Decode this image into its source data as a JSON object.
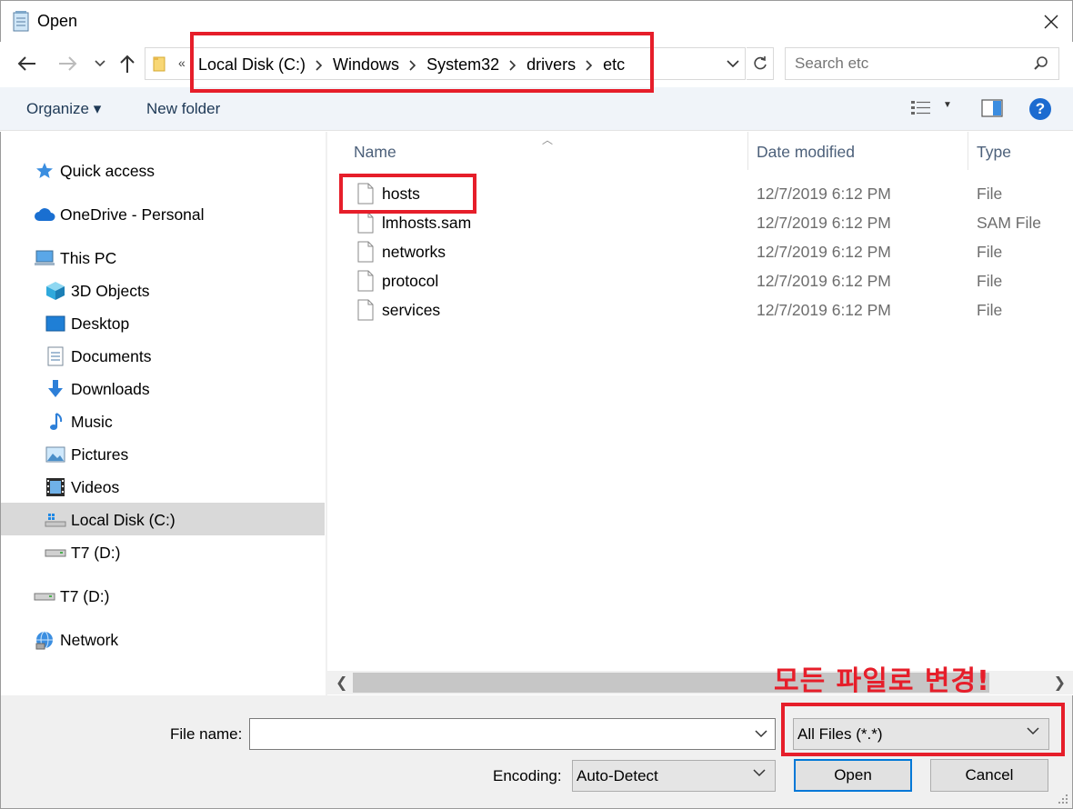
{
  "window": {
    "title": "Open"
  },
  "nav": {
    "back_label": "←",
    "forward_label": "→",
    "recent_label": "⌄",
    "up_label": "↑",
    "overflow_label": "«",
    "breadcrumbs": [
      "Local Disk (C:)",
      "Windows",
      "System32",
      "drivers",
      "etc"
    ],
    "search_placeholder": "Search etc"
  },
  "toolbar": {
    "organize_label": "Organize ▾",
    "new_folder_label": "New folder",
    "help_label": "?"
  },
  "sidebar": {
    "items": [
      {
        "label": "Quick access",
        "icon": "star-icon"
      },
      {
        "label": "OneDrive - Personal",
        "icon": "cloud-icon"
      },
      {
        "label": "This PC",
        "icon": "computer-icon"
      },
      {
        "label": "3D Objects",
        "icon": "cube-icon"
      },
      {
        "label": "Desktop",
        "icon": "desktop-icon"
      },
      {
        "label": "Documents",
        "icon": "documents-icon"
      },
      {
        "label": "Downloads",
        "icon": "download-icon"
      },
      {
        "label": "Music",
        "icon": "music-icon"
      },
      {
        "label": "Pictures",
        "icon": "pictures-icon"
      },
      {
        "label": "Videos",
        "icon": "videos-icon"
      },
      {
        "label": "Local Disk (C:)",
        "icon": "drive-icon",
        "selected": true
      },
      {
        "label": "T7 (D:)",
        "icon": "usb-drive-icon"
      },
      {
        "label": "T7 (D:)",
        "icon": "usb-drive-icon"
      },
      {
        "label": "Network",
        "icon": "network-icon"
      }
    ]
  },
  "columns": {
    "name": "Name",
    "date": "Date modified",
    "type": "Type"
  },
  "files": [
    {
      "name": "hosts",
      "date": "12/7/2019 6:12 PM",
      "type": "File"
    },
    {
      "name": "lmhosts.sam",
      "date": "12/7/2019 6:12 PM",
      "type": "SAM File"
    },
    {
      "name": "networks",
      "date": "12/7/2019 6:12 PM",
      "type": "File"
    },
    {
      "name": "protocol",
      "date": "12/7/2019 6:12 PM",
      "type": "File"
    },
    {
      "name": "services",
      "date": "12/7/2019 6:12 PM",
      "type": "File"
    }
  ],
  "footer": {
    "file_name_label": "File name:",
    "file_name_value": "",
    "filter_value": "All Files  (*.*)",
    "encoding_label": "Encoding:",
    "encoding_value": "Auto-Detect",
    "open_label": "Open",
    "cancel_label": "Cancel"
  },
  "annotation": {
    "text": "모든 파일로 변경!"
  },
  "colors": {
    "highlight_red": "#e61e2a",
    "accent_blue": "#0078d7",
    "selected_bg": "#d9d9d9"
  }
}
